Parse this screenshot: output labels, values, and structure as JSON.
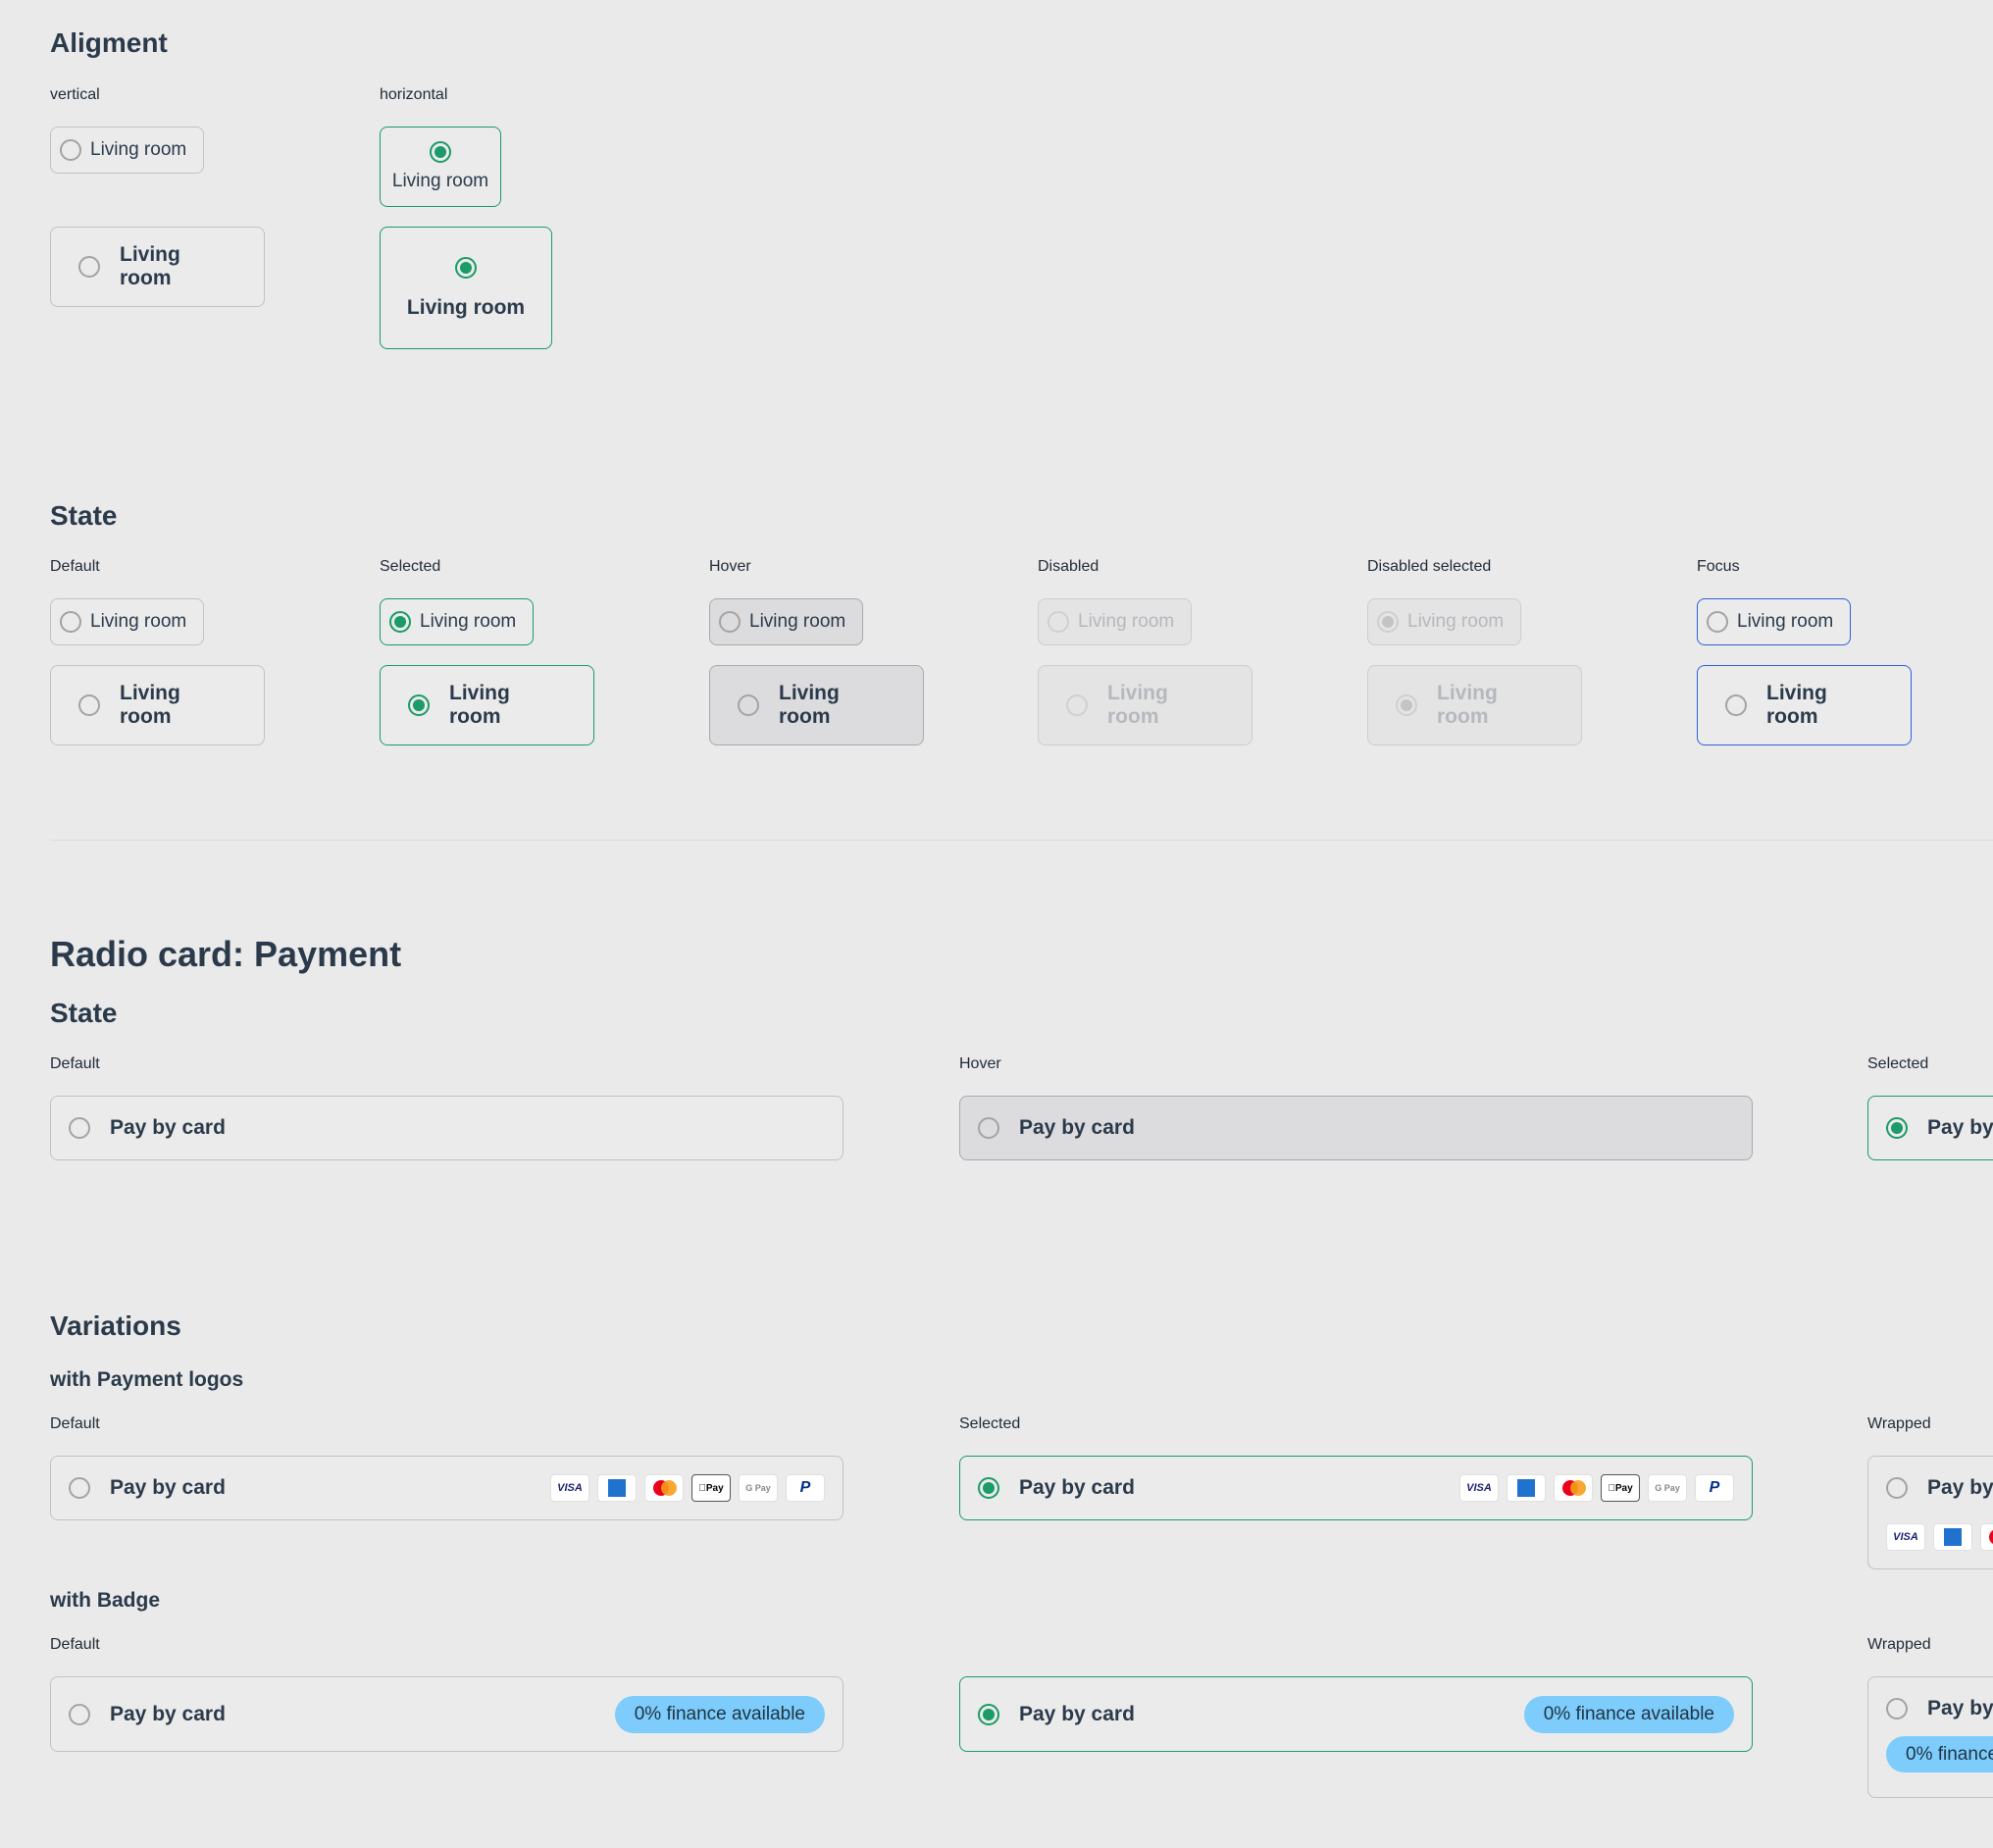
{
  "alignment": {
    "title": "Aligment",
    "vertical_label": "vertical",
    "horizontal_label": "horizontal",
    "option": "Living room"
  },
  "state": {
    "title": "State",
    "labels": [
      "Default",
      "Selected",
      "Hover",
      "Disabled",
      "Disabled selected",
      "Focus"
    ],
    "option": "Living room"
  },
  "payment": {
    "title": "Radio card: Payment",
    "state_title": "State",
    "state_labels": [
      "Default",
      "Hover",
      "Selected"
    ],
    "option": "Pay by card",
    "variations_title": "Variations",
    "logos_title": "with Payment logos",
    "logos_labels": [
      "Default",
      "Selected",
      "Wrapped"
    ],
    "logos": [
      "VISA",
      "AMEX",
      "Mastercard",
      "Apple Pay",
      "G Pay",
      "PayPal"
    ],
    "badge_title": "with Badge",
    "badge_labels": [
      "Default",
      "Wrapped"
    ],
    "badge_text": "0% finance available"
  },
  "colors": {
    "background": "#eaeaea",
    "selected": "#1a9b67",
    "focus": "#2f5fd6",
    "badge": "#7dccfb"
  }
}
